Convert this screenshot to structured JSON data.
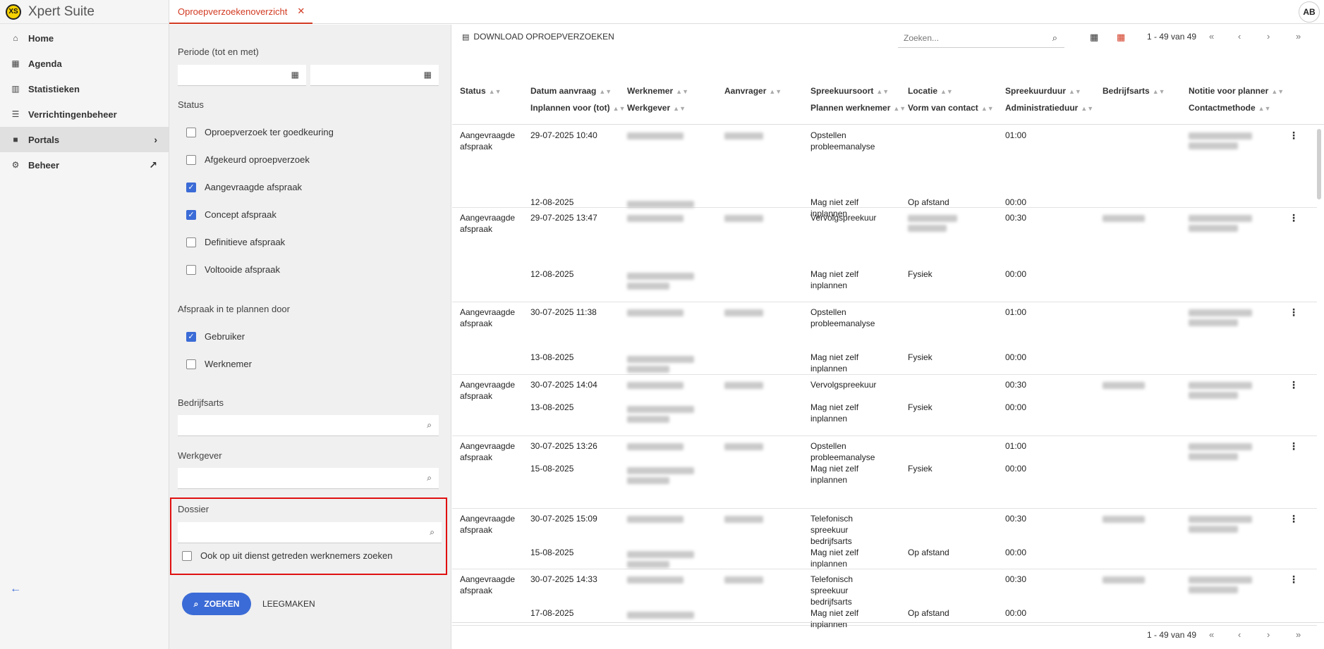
{
  "app": {
    "logo_text": "XS",
    "title": "Xpert Suite",
    "user_initials": "AB"
  },
  "nav": {
    "items": [
      {
        "label": "Home",
        "icon": "home-icon"
      },
      {
        "label": "Agenda",
        "icon": "calendar-icon"
      },
      {
        "label": "Statistieken",
        "icon": "chart-icon"
      },
      {
        "label": "Verrichtingenbeheer",
        "icon": "list-icon"
      },
      {
        "label": "Portals",
        "icon": "folder-icon"
      },
      {
        "label": "Beheer",
        "icon": "gear-icon"
      }
    ],
    "active": "Portals"
  },
  "tabs": [
    {
      "label": "Oproepverzoekenoverzicht",
      "close": "✕"
    }
  ],
  "filters": {
    "period_label": "Periode (tot en met)",
    "status_label": "Status",
    "status_options": [
      {
        "label": "Oproepverzoek ter goedkeuring",
        "checked": false
      },
      {
        "label": "Afgekeurd oproepverzoek",
        "checked": false
      },
      {
        "label": "Aangevraagde afspraak",
        "checked": true
      },
      {
        "label": "Concept afspraak",
        "checked": true
      },
      {
        "label": "Definitieve afspraak",
        "checked": false
      },
      {
        "label": "Voltooide afspraak",
        "checked": false
      }
    ],
    "planner_label": "Afspraak in te plannen door",
    "planner_options": [
      {
        "label": "Gebruiker",
        "checked": true
      },
      {
        "label": "Werknemer",
        "checked": false
      }
    ],
    "bedrijfsarts_label": "Bedrijfsarts",
    "werkgever_label": "Werkgever",
    "dossier_label": "Dossier",
    "dossier_checkbox": {
      "label": "Ook op uit dienst getreden werknemers zoeken",
      "checked": false
    },
    "search_button": "ZOEKEN",
    "clear_button": "LEEGMAKEN"
  },
  "toolbar": {
    "download_label": "DOWNLOAD OPROEPVERZOEKEN",
    "search_placeholder": "Zoeken...",
    "pagination": "1 - 49 van 49"
  },
  "columns": {
    "row1": [
      "Status",
      "Datum aanvraag",
      "Werknemer",
      "Aanvrager",
      "Spreekuursoort",
      "Locatie",
      "Spreekuurduur",
      "Bedrijfsarts",
      "Notitie voor planner"
    ],
    "row2": [
      "Inplannen voor (tot)",
      "Werkgever",
      "Plannen werknemer",
      "Vorm van contact",
      "Administratieduur",
      "Contactmethode"
    ]
  },
  "rows": [
    {
      "status": "Aangevraagde afspraak",
      "datum": "29-07-2025 10:40",
      "soort": "Opstellen probleemanalyse",
      "duur": "01:00",
      "inplannen": "12-08-2025",
      "plannen": "Mag niet zelf inplannen",
      "vorm": "Op afstand",
      "admin": "00:00"
    },
    {
      "status": "Aangevraagde afspraak",
      "datum": "29-07-2025 13:47",
      "soort": "Vervolgspreekuur",
      "duur": "00:30",
      "inplannen": "12-08-2025",
      "plannen": "Mag niet zelf inplannen",
      "vorm": "Fysiek",
      "admin": "00:00"
    },
    {
      "status": "Aangevraagde afspraak",
      "datum": "30-07-2025 11:38",
      "soort": "Opstellen probleemanalyse",
      "duur": "01:00",
      "inplannen": "13-08-2025",
      "plannen": "Mag niet zelf inplannen",
      "vorm": "Fysiek",
      "admin": "00:00"
    },
    {
      "status": "Aangevraagde afspraak",
      "datum": "30-07-2025 14:04",
      "soort": "Vervolgspreekuur",
      "duur": "00:30",
      "inplannen": "13-08-2025",
      "plannen": "Mag niet zelf inplannen",
      "vorm": "Fysiek",
      "admin": "00:00"
    },
    {
      "status": "Aangevraagde afspraak",
      "datum": "30-07-2025 13:26",
      "soort": "Opstellen probleemanalyse",
      "duur": "01:00",
      "inplannen": "15-08-2025",
      "plannen": "Mag niet zelf inplannen",
      "vorm": "Fysiek",
      "admin": "00:00"
    },
    {
      "status": "Aangevraagde afspraak",
      "datum": "30-07-2025 15:09",
      "soort": "Telefonisch spreekuur bedrijfsarts",
      "duur": "00:30",
      "inplannen": "15-08-2025",
      "plannen": "Mag niet zelf inplannen",
      "vorm": "Op afstand",
      "admin": "00:00"
    },
    {
      "status": "Aangevraagde afspraak",
      "datum": "30-07-2025 14:33",
      "soort": "Telefonisch spreekuur bedrijfsarts",
      "duur": "00:30",
      "inplannen": "17-08-2025",
      "plannen": "Mag niet zelf inplannen",
      "vorm": "Op afstand",
      "admin": "00:00"
    }
  ],
  "colors": {
    "accent": "#3b6bd6",
    "tab_active": "#d23a22",
    "highlight": "#e01010"
  }
}
